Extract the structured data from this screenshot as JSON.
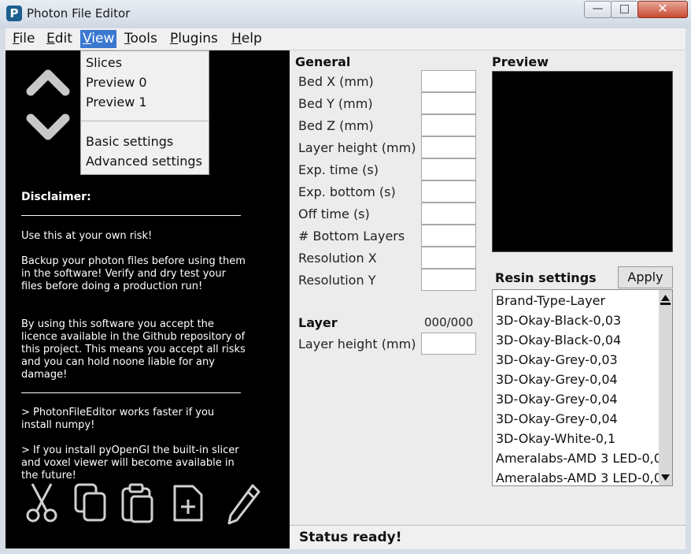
{
  "window": {
    "title": "Photon File Editor",
    "icon_letter": "P",
    "minimize_glyph": "—",
    "maximize_glyph": "□",
    "close_glyph": "✕"
  },
  "menubar": {
    "items": [
      {
        "label": "File",
        "key": "F",
        "rest": "ile"
      },
      {
        "label": "Edit",
        "key": "E",
        "rest": "dit"
      },
      {
        "label": "View",
        "key": "V",
        "rest": "iew"
      },
      {
        "label": "Tools",
        "key": "T",
        "rest": "ools"
      },
      {
        "label": "Plugins",
        "key": "P",
        "rest": "lugins"
      },
      {
        "label": "Help",
        "key": "H",
        "rest": "elp"
      }
    ]
  },
  "view_menu": {
    "items": [
      "Slices",
      "Preview 0",
      "Preview 1",
      "Basic settings",
      "Advanced settings"
    ]
  },
  "left_panel": {
    "disclaimer_title": "Disclaimer:",
    "paragraphs": [
      "Use this at your own risk!",
      "Backup your photon files before using them in the software! Verify and dry test your files before doing a production run!",
      "By using this software you accept the licence available in the Github repository of this project. This means you accept all risks and you can hold noone liable for any damage!"
    ],
    "tips": [
      "> PhotonFileEditor works faster if you install numpy!",
      "> If you install pyOpenGl the built-in slicer and voxel viewer will become available in the future!"
    ],
    "icons": [
      "up-arrow-icon",
      "down-arrow-icon",
      "cut-icon",
      "copy-icon",
      "paste-icon",
      "add-layer-icon",
      "edit-pencil-icon"
    ]
  },
  "general": {
    "heading": "General",
    "fields": [
      {
        "label": "Bed X (mm)",
        "value": ""
      },
      {
        "label": "Bed Y (mm)",
        "value": ""
      },
      {
        "label": "Bed Z (mm)",
        "value": ""
      },
      {
        "label": "Layer height (mm)",
        "value": ""
      },
      {
        "label": "Exp. time (s)",
        "value": ""
      },
      {
        "label": "Exp. bottom (s)",
        "value": ""
      },
      {
        "label": "Off time (s)",
        "value": ""
      },
      {
        "label": "# Bottom Layers",
        "value": ""
      },
      {
        "label": "Resolution X",
        "value": ""
      },
      {
        "label": "Resolution Y",
        "value": ""
      }
    ]
  },
  "layer": {
    "heading": "Layer",
    "counter": "000/000",
    "field_label": "Layer height (mm)",
    "field_value": ""
  },
  "preview": {
    "heading": "Preview"
  },
  "resin": {
    "heading": "Resin settings",
    "apply_label": "Apply",
    "items": [
      "Brand-Type-Layer",
      "3D-Okay-Black-0,03",
      "3D-Okay-Black-0,04",
      "3D-Okay-Grey-0,03",
      "3D-Okay-Grey-0,04",
      "3D-Okay-Grey-0,04",
      "3D-Okay-Grey-0,04",
      "3D-Okay-White-0,1",
      "Ameralabs-AMD 3 LED-0,0",
      "Ameralabs-AMD 3 LED-0,0"
    ]
  },
  "status": {
    "text": "Status ready!"
  },
  "colors": {
    "accent": "#3a78d0",
    "panel_bg": "#000000",
    "close_button": "#c94a32"
  }
}
